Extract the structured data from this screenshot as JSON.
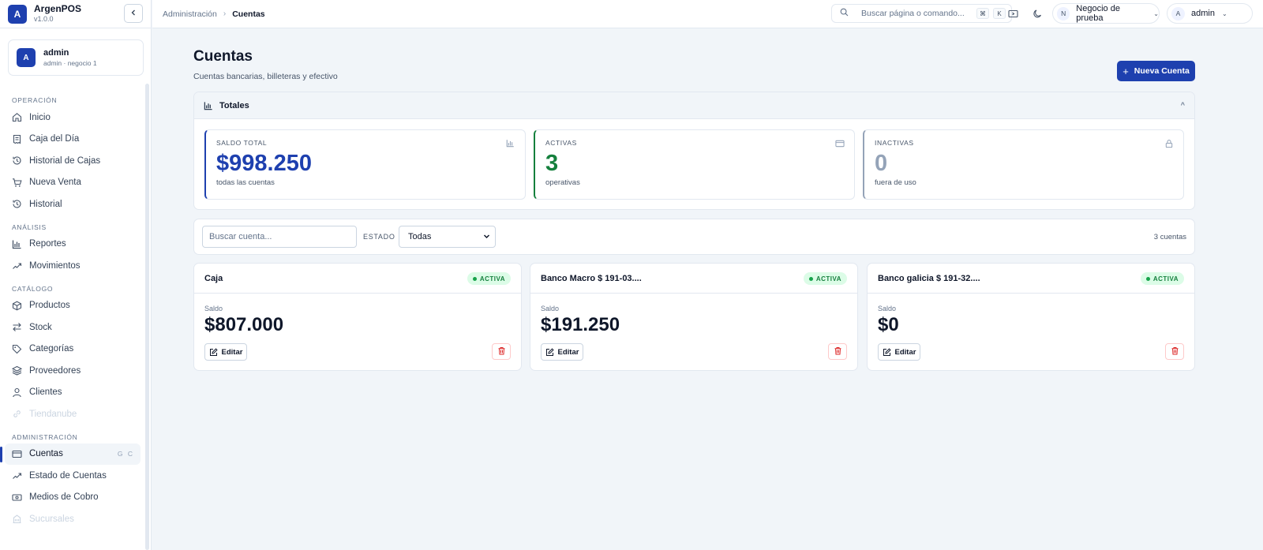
{
  "app": {
    "name": "ArgenPOS",
    "version": "v1.0.0",
    "collapse_icon": "chevron-left-icon"
  },
  "user": {
    "avatar": "A",
    "name": "admin",
    "sub": "admin · negocio 1"
  },
  "nav": {
    "sections": [
      {
        "title": "OPERACIÓN",
        "items": [
          {
            "label": "Inicio",
            "icon": "home-icon"
          },
          {
            "label": "Caja del Día",
            "icon": "receipt-icon"
          },
          {
            "label": "Historial de Cajas",
            "icon": "history-icon"
          },
          {
            "label": "Nueva Venta",
            "icon": "cart-icon"
          },
          {
            "label": "Historial",
            "icon": "history-icon"
          }
        ]
      },
      {
        "title": "ANÁLISIS",
        "items": [
          {
            "label": "Reportes",
            "icon": "bar-chart-icon"
          },
          {
            "label": "Movimientos",
            "icon": "trend-icon"
          }
        ]
      },
      {
        "title": "CATÁLOGO",
        "items": [
          {
            "label": "Productos",
            "icon": "box-icon"
          },
          {
            "label": "Stock",
            "icon": "swap-icon"
          },
          {
            "label": "Categorías",
            "icon": "tag-icon"
          },
          {
            "label": "Proveedores",
            "icon": "layers-icon"
          },
          {
            "label": "Clientes",
            "icon": "user-icon"
          },
          {
            "label": "Tiendanube",
            "icon": "link-icon",
            "disabled": true
          }
        ]
      },
      {
        "title": "ADMINISTRACIÓN",
        "items": [
          {
            "label": "Cuentas",
            "icon": "card-icon",
            "active": true,
            "shortcut": "G C"
          },
          {
            "label": "Estado de Cuentas",
            "icon": "trend-icon"
          },
          {
            "label": "Medios de Cobro",
            "icon": "banknote-icon"
          },
          {
            "label": "Sucursales",
            "icon": "building-icon",
            "disabled": true
          }
        ]
      }
    ]
  },
  "topbar": {
    "breadcrumb": [
      "Administración",
      "Cuentas"
    ],
    "search_placeholder": "Buscar página o comando...",
    "kbd": [
      "⌘",
      "K"
    ],
    "business": {
      "avatar": "N",
      "label": "Negocio de prueba"
    },
    "account": {
      "avatar": "A",
      "label": "admin"
    }
  },
  "page": {
    "title": "Cuentas",
    "subtitle": "Cuentas bancarias, billeteras y efectivo",
    "new_button": "Nueva Cuenta"
  },
  "totals": {
    "title": "Totales",
    "stats": [
      {
        "label": "SALDO TOTAL",
        "value": "$998.250",
        "sub": "todas las cuentas",
        "color": "#1e40af",
        "icon": "bar-chart-icon"
      },
      {
        "label": "ACTIVAS",
        "value": "3",
        "sub": "operativas",
        "color": "#15803d",
        "icon": "card-icon"
      },
      {
        "label": "INACTIVAS",
        "value": "0",
        "sub": "fuera de uso",
        "color": "#94a3b8",
        "icon": "lock-icon"
      }
    ]
  },
  "filter": {
    "search_placeholder": "Buscar cuenta...",
    "estado_label": "ESTADO",
    "estado_value": "Todas",
    "count": "3 cuentas"
  },
  "accounts": [
    {
      "name": "Caja",
      "status": "ACTIVA",
      "saldo_label": "Saldo",
      "saldo": "$807.000",
      "edit": "Editar"
    },
    {
      "name": "Banco Macro $ 191-03....",
      "status": "ACTIVA",
      "saldo_label": "Saldo",
      "saldo": "$191.250",
      "edit": "Editar"
    },
    {
      "name": "Banco galicia $ 191-32....",
      "status": "ACTIVA",
      "saldo_label": "Saldo",
      "saldo": "$0",
      "edit": "Editar"
    }
  ]
}
